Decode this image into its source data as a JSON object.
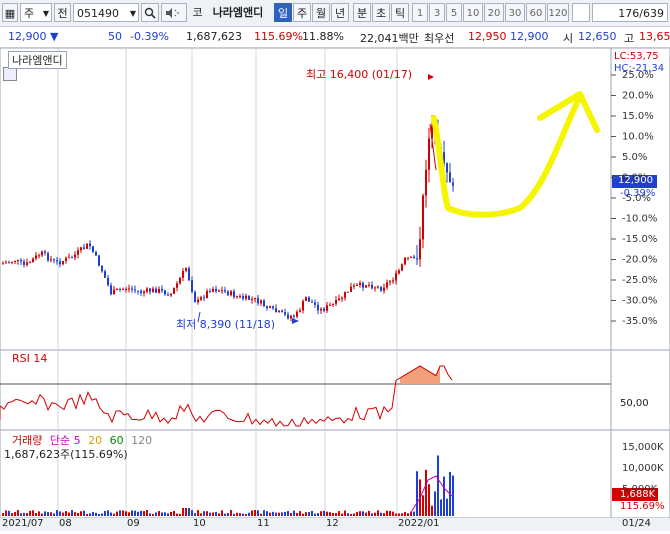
{
  "toolbar": {
    "market": "주",
    "prev": "전",
    "code": "051490",
    "search_icon": "search-icon",
    "sound_icon": "speaker-icon",
    "market_badge": "코",
    "stock_name": "나라엠앤디",
    "periods": [
      "일",
      "주",
      "월",
      "년",
      "분",
      "초",
      "틱"
    ],
    "selected_period": "일",
    "minutes": [
      "1",
      "3",
      "5",
      "10",
      "20",
      "30",
      "60",
      "120"
    ],
    "page_counter": "176",
    "page_total": "/639"
  },
  "info": {
    "price": "12,900 ▼",
    "change": "50",
    "change_pct": "-0.39%",
    "volume": "1,687,623",
    "volume_pct": "115.69%",
    "turnover": "11.88%",
    "amount": "22,041백만",
    "ask_label": "최우선",
    "ask": "12,950",
    "bid": "12,900",
    "open_label": "시",
    "open": "12,650",
    "high_label": "고",
    "high": "13,65"
  },
  "price_panel": {
    "title": "나라엠앤디",
    "high_label": "최고 16,400 (01/17)",
    "low_label": "최저 8,390 (11/18)",
    "lc": "LC:53,75",
    "hc": "HC:-21,34",
    "current_price_tag": "12,900",
    "current_pct_tag": "-0.39%",
    "right_axis": [
      "25.0%",
      "20.0%",
      "15.0%",
      "10.0%",
      "5.0%",
      "0.0%",
      "-5.0%",
      "-10.0%",
      "-15.0%",
      "-20.0%",
      "-25.0%",
      "-30.0%",
      "-35.0%"
    ]
  },
  "rsi_panel": {
    "title": "RSI 14",
    "axis_label": "50,00"
  },
  "volume_panel": {
    "title": "거래량",
    "ma_label": "단순",
    "ma_periods": [
      "5",
      "20",
      "60",
      "120"
    ],
    "value_text": "1,687,623주(115.69%)",
    "right_axis": [
      "15,000K",
      "10,000K",
      "5,000K"
    ],
    "current_tag": "1,688K",
    "pct_tag": "115.69%"
  },
  "x_axis": [
    "2021/07",
    "08",
    "09",
    "10",
    "11",
    "12",
    "2022/01",
    "01/24"
  ],
  "colors": {
    "up": "#d20000",
    "down": "#1f3fd1",
    "rsi_line": "#d20000",
    "rsi_fill": "#f2a07c",
    "annotation": "#f5f500"
  },
  "chart_data": {
    "type": "candlestick",
    "x_range": [
      "2021/07",
      "2022/01/24"
    ],
    "key_points": [
      {
        "x": "2021/11/18",
        "y": 8390,
        "label": "최저"
      },
      {
        "x": "2022/01/17",
        "y": 16400,
        "label": "최고"
      },
      {
        "x": "2022/01/24",
        "y": 12900,
        "label": "current"
      }
    ]
  }
}
